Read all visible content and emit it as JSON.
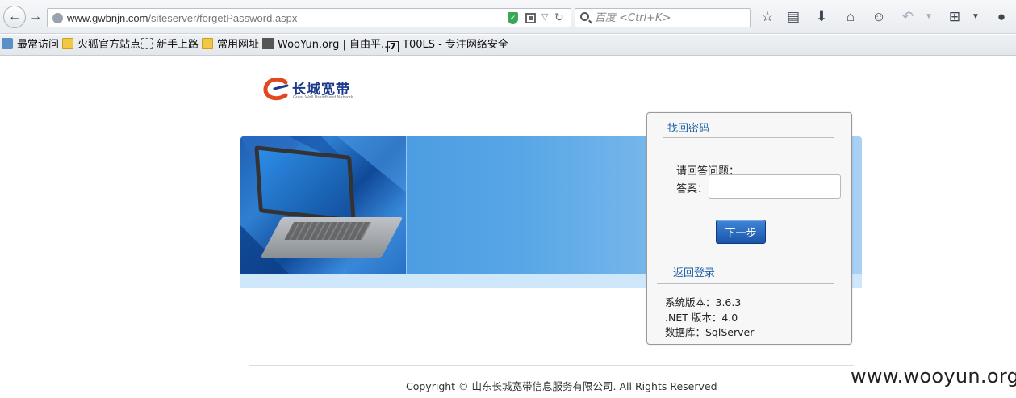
{
  "browser": {
    "url_host": "www.gwbnjn.com",
    "url_path": "/siteserver/forgetPassword.aspx",
    "search_placeholder": "百度 <Ctrl+K>",
    "bookmarks": [
      {
        "label": "最常访问",
        "icon": "person-icon"
      },
      {
        "label": "火狐官方站点",
        "icon": "folder-icon"
      },
      {
        "label": "新手上路",
        "icon": "dashed-page-icon"
      },
      {
        "label": "常用网址",
        "icon": "folder-icon"
      },
      {
        "label": "WooYun.org | 自由平...",
        "icon": "wooyun-icon"
      },
      {
        "label": "T00LS - 专注网络安全",
        "icon": "tools-7-icon"
      }
    ]
  },
  "page": {
    "logo_text": "长城宽带",
    "logo_sub": "Great Wall Broadband Network",
    "panel": {
      "title": "找回密码",
      "question_label": "请回答问题：",
      "answer_label": "答案：",
      "answer_value": "",
      "next_button": "下一步",
      "back_login": "返回登录",
      "info": [
        "系统版本：3.6.3",
        ".NET 版本：4.0",
        "数据库：SqlServer"
      ]
    },
    "footer": "Copyright © 山东长城宽带信息服务有限公司. All Rights Reserved"
  },
  "watermark": "www.wooyun.org",
  "colors": {
    "link_blue": "#1d5fa8",
    "button_blue": "#1b55a8",
    "banner_blue": "#3b8fdc"
  }
}
